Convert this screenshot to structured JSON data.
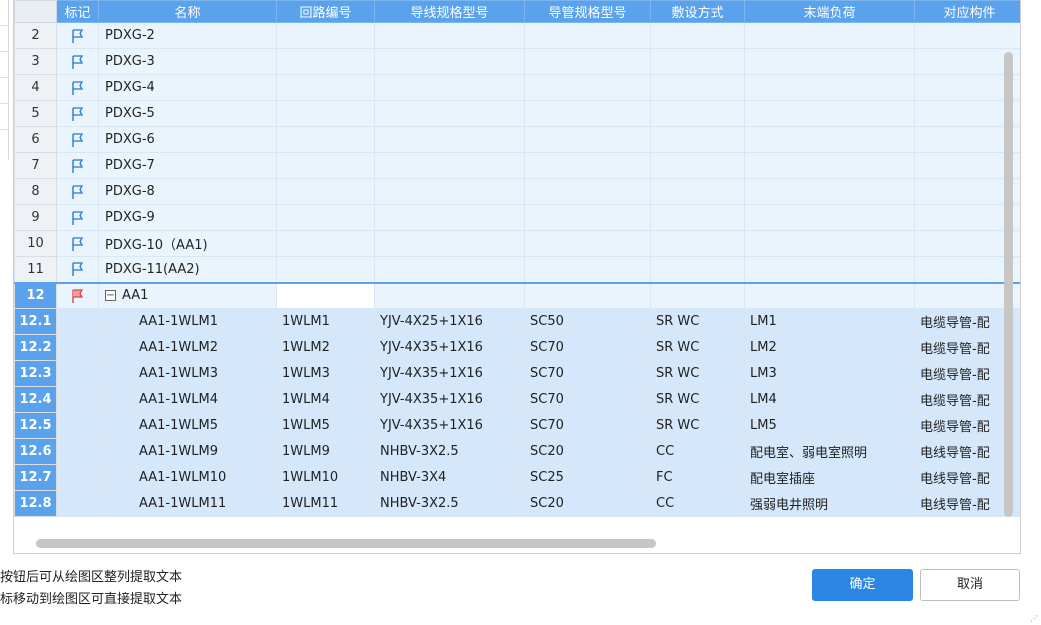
{
  "columns": [
    "标记",
    "名称",
    "回路编号",
    "导线规格型号",
    "导管规格型号",
    "敷设方式",
    "末端负荷",
    "对应构件"
  ],
  "rows": [
    {
      "num": "2",
      "name": "PDXG-2"
    },
    {
      "num": "3",
      "name": "PDXG-3"
    },
    {
      "num": "4",
      "name": "PDXG-4"
    },
    {
      "num": "5",
      "name": "PDXG-5"
    },
    {
      "num": "6",
      "name": "PDXG-6"
    },
    {
      "num": "7",
      "name": "PDXG-7"
    },
    {
      "num": "8",
      "name": "PDXG-8"
    },
    {
      "num": "9",
      "name": "PDXG-9"
    },
    {
      "num": "10",
      "name": "PDXG-10（AA1)"
    },
    {
      "num": "11",
      "name": "PDXG-11(AA2)"
    }
  ],
  "group": {
    "num": "12",
    "toggle": "−",
    "name": "AA1"
  },
  "children": [
    {
      "num": "12.1",
      "name": "AA1-1WLM1",
      "loop": "1WLM1",
      "wire": "YJV-4X25+1X16",
      "pipe": "SC50",
      "method": "SR WC",
      "load": "LM1",
      "component": "电缆导管-配"
    },
    {
      "num": "12.2",
      "name": "AA1-1WLM2",
      "loop": "1WLM2",
      "wire": "YJV-4X35+1X16",
      "pipe": "SC70",
      "method": "SR WC",
      "load": "LM2",
      "component": "电缆导管-配"
    },
    {
      "num": "12.3",
      "name": "AA1-1WLM3",
      "loop": "1WLM3",
      "wire": "YJV-4X35+1X16",
      "pipe": "SC70",
      "method": "SR WC",
      "load": "LM3",
      "component": "电缆导管-配"
    },
    {
      "num": "12.4",
      "name": "AA1-1WLM4",
      "loop": "1WLM4",
      "wire": "YJV-4X35+1X16",
      "pipe": "SC70",
      "method": "SR WC",
      "load": "LM4",
      "component": "电缆导管-配"
    },
    {
      "num": "12.5",
      "name": "AA1-1WLM5",
      "loop": "1WLM5",
      "wire": "YJV-4X35+1X16",
      "pipe": "SC70",
      "method": "SR WC",
      "load": "LM5",
      "component": "电缆导管-配"
    },
    {
      "num": "12.6",
      "name": "AA1-1WLM9",
      "loop": "1WLM9",
      "wire": "NHBV-3X2.5",
      "pipe": "SC20",
      "method": "CC",
      "load": "配电室、弱电室照明",
      "component": "电线导管-配"
    },
    {
      "num": "12.7",
      "name": "AA1-1WLM10",
      "loop": "1WLM10",
      "wire": "NHBV-3X4",
      "pipe": "SC25",
      "method": "FC",
      "load": "配电室插座",
      "component": "电线导管-配"
    },
    {
      "num": "12.8",
      "name": "AA1-1WLM11",
      "loop": "1WLM11",
      "wire": "NHBV-3X2.5",
      "pipe": "SC20",
      "method": "CC",
      "load": "强弱电井照明",
      "component": "电线导管-配"
    }
  ],
  "hints": [
    "按钮后可从绘图区整列提取文本",
    "标移动到绘图区可直接提取文本"
  ],
  "buttons": {
    "ok": "确定",
    "cancel": "取消"
  },
  "icons": {
    "flag": "flag-icon",
    "flag_active": "flag-red-icon",
    "toggle": "collapse-icon"
  },
  "colors": {
    "header": "#5aa2ec",
    "primary_button": "#2b86e3",
    "selected_row": "#d4e7fb",
    "plain_row": "#eaf4fd"
  }
}
